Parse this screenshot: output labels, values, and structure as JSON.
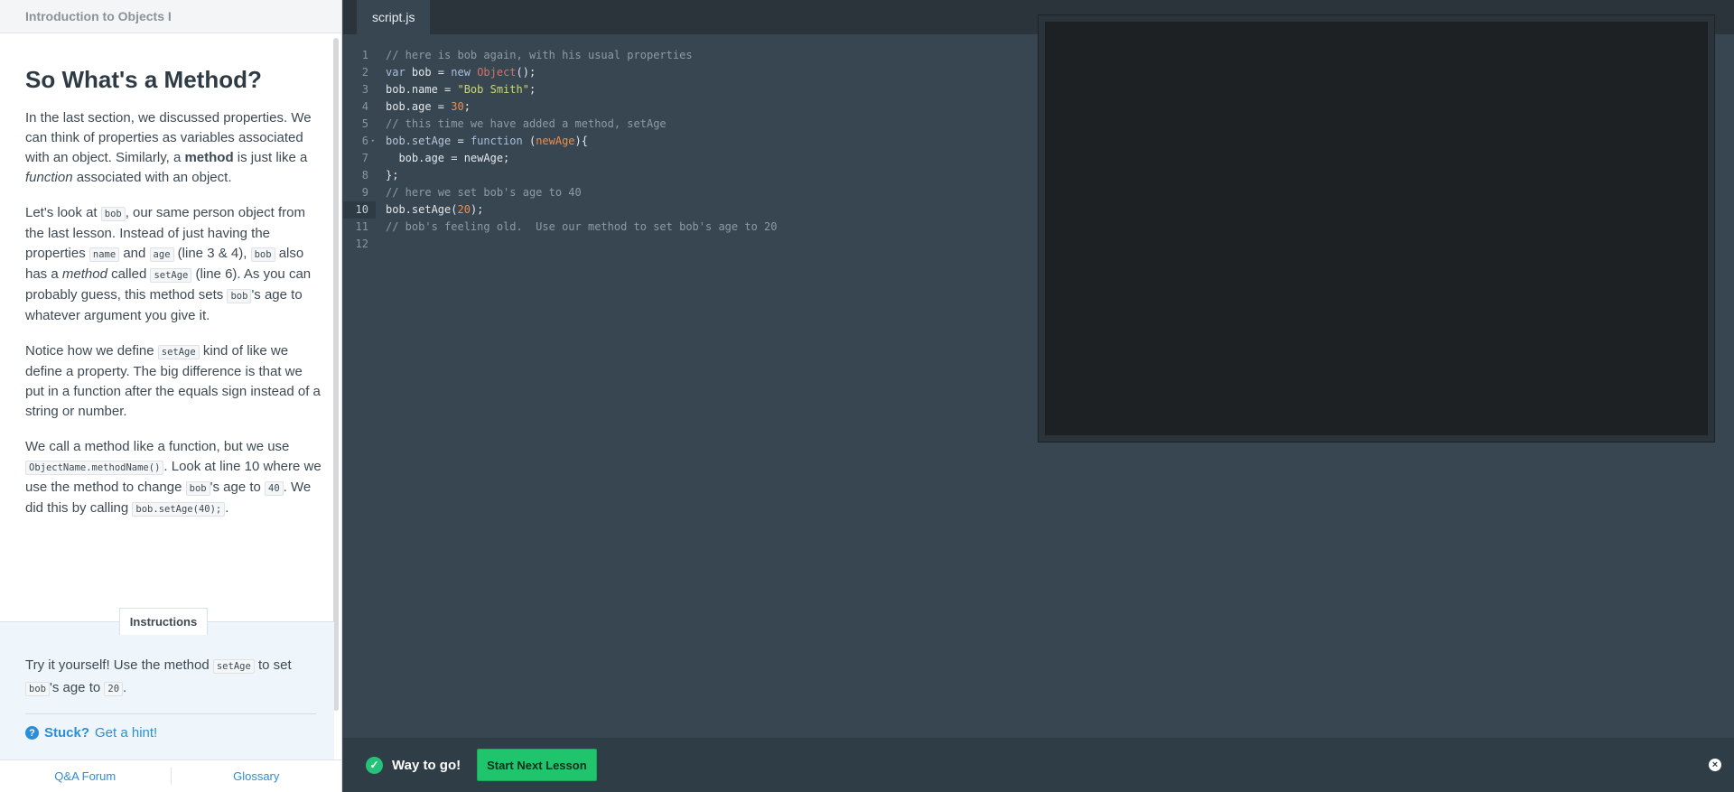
{
  "left_panel": {
    "course_title": "Introduction to Objects I",
    "lesson": {
      "heading": "So What's a Method?",
      "p1": {
        "t1": "In the last section, we discussed properties. We can think of properties as variables associated with an object. Similarly, a ",
        "bold": "method",
        "t2": " is just like a ",
        "italic": "function",
        "t3": " associated with an object."
      },
      "p2": {
        "t1": "Let's look at ",
        "code1": "bob",
        "t2": ", our same person object from the last lesson. Instead of just having the properties ",
        "code2": "name",
        "t3": " and ",
        "code3": "age",
        "t4": " (line 3 & 4), ",
        "code4": "bob",
        "t5": " also has a ",
        "italic": "method",
        "t6": " called ",
        "code5": "setAge",
        "t7": " (line 6). As you can probably guess, this method sets ",
        "code6": "bob",
        "t8": "'s age to whatever argument you give it."
      },
      "p3": {
        "t1": "Notice how we define ",
        "code1": "setAge",
        "t2": " kind of like we define a property. The big difference is that we put in a function after the equals sign instead of a string or number."
      },
      "p4": {
        "t1": "We call a method like a function, but we use ",
        "code1": "ObjectName.methodName()",
        "t2": ". Look at line 10 where we use the method to change ",
        "code2": "bob",
        "t3": "'s age to ",
        "code3": "40",
        "t4": ". We did this by calling ",
        "code4": "bob.setAge(40);",
        "t5": "."
      }
    },
    "instructions": {
      "tab_label": "Instructions",
      "t1": "Try it yourself! Use the method ",
      "code1": "setAge",
      "t2": " to set ",
      "code2": "bob",
      "t3": "'s age to ",
      "code3": "20",
      "t4": ".",
      "hint_icon": "question-circle-icon",
      "hint_glyph": "?",
      "hint_stuck": "Stuck?",
      "hint_link": "Get a hint!"
    },
    "footer": {
      "forum": "Q&A Forum",
      "glossary": "Glossary"
    }
  },
  "editor": {
    "tab_label": "script.js",
    "line_numbers": [
      "1",
      "2",
      "3",
      "4",
      "5",
      "6",
      "7",
      "8",
      "9",
      "10",
      "11",
      "12"
    ],
    "active_line": "10",
    "lines": {
      "l1": "// here is bob again, with his usual properties",
      "l2": {
        "a": "var",
        "b": " bob = ",
        "c": "new",
        "d": " ",
        "e": "Object",
        "f": "();"
      },
      "l3": {
        "a": "bob.name = ",
        "b": "\"Bob Smith\"",
        "c": ";"
      },
      "l4": {
        "a": "bob.age = ",
        "b": "30",
        "c": ";"
      },
      "l5": "// this time we have added a method, setAge",
      "l6": {
        "a": "bob.setAge",
        "b": " = ",
        "c": "function",
        "d": " (",
        "e": "newAge",
        "f": "){"
      },
      "l7": "  bob.age = newAge;",
      "l8": "};",
      "l9": "// here we set bob's age to 40",
      "l10": {
        "a": "bob.setAge(",
        "b": "20",
        "c": ");"
      },
      "l11": "// bob's feeling old.  Use our method to set bob's age to 20",
      "l12": ""
    }
  },
  "success_bar": {
    "check_glyph": "✓",
    "message": "Way to go!",
    "button": "Start Next Lesson",
    "close_glyph": "×"
  }
}
